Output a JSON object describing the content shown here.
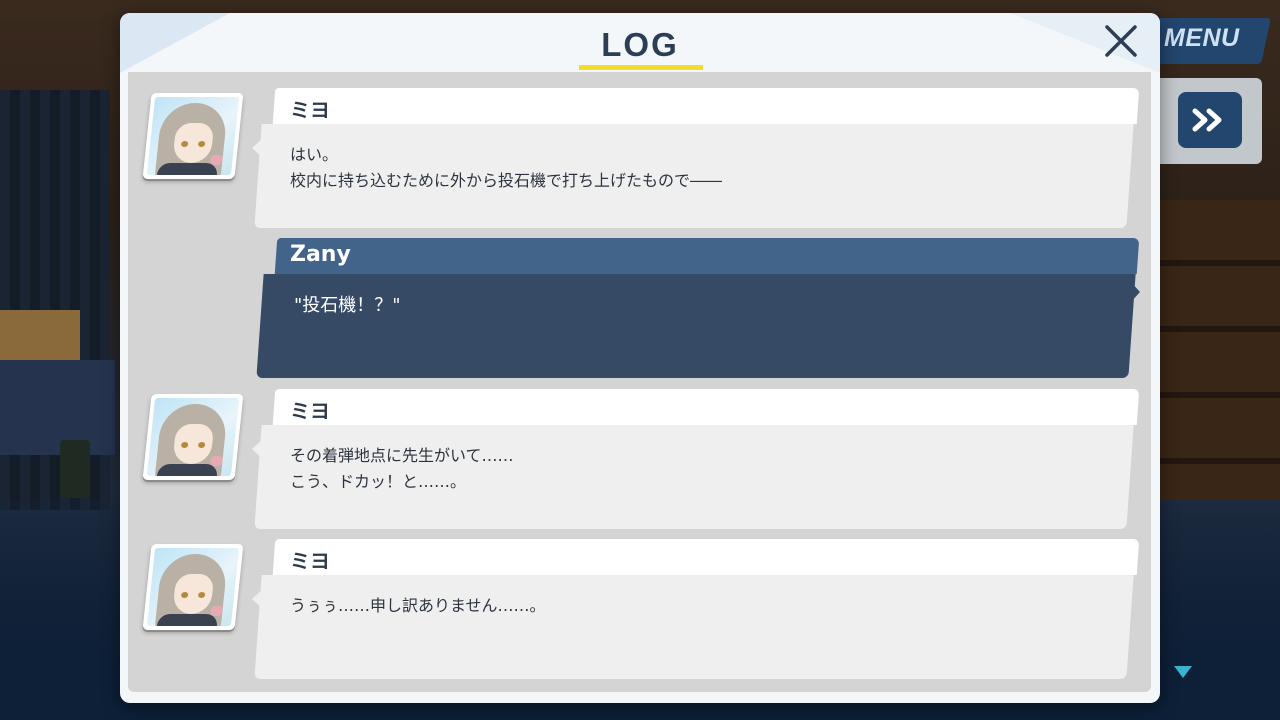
{
  "header": {
    "title": "LOG",
    "close_icon": "close-icon"
  },
  "menu": {
    "label": "MENU",
    "fast_forward_icon": "fast-forward-icon"
  },
  "log_entries": [
    {
      "speaker": "ミヨ",
      "lines": [
        "はい。",
        "校内に持ち込むために外から投石機で打ち上げたもので――"
      ]
    },
    {
      "speaker": "Zany",
      "lines": [
        "\"投石機！？\""
      ],
      "is_player": true
    },
    {
      "speaker": "ミヨ",
      "lines": [
        "その着弾地点に先生がいて……",
        "こう、ドカッ！と……。"
      ]
    },
    {
      "speaker": "ミヨ",
      "lines": [
        "うぅぅ……申し訳ありません……。"
      ]
    }
  ],
  "colors": {
    "accent_yellow": "#f2de2a",
    "player_bubble": "#364a66",
    "player_name_bar": "#43648a",
    "menu_button": "#23466e",
    "scroll_indicator": "#3bb3cc"
  },
  "scroll_indicator_icon": "scroll-down-arrow-icon"
}
